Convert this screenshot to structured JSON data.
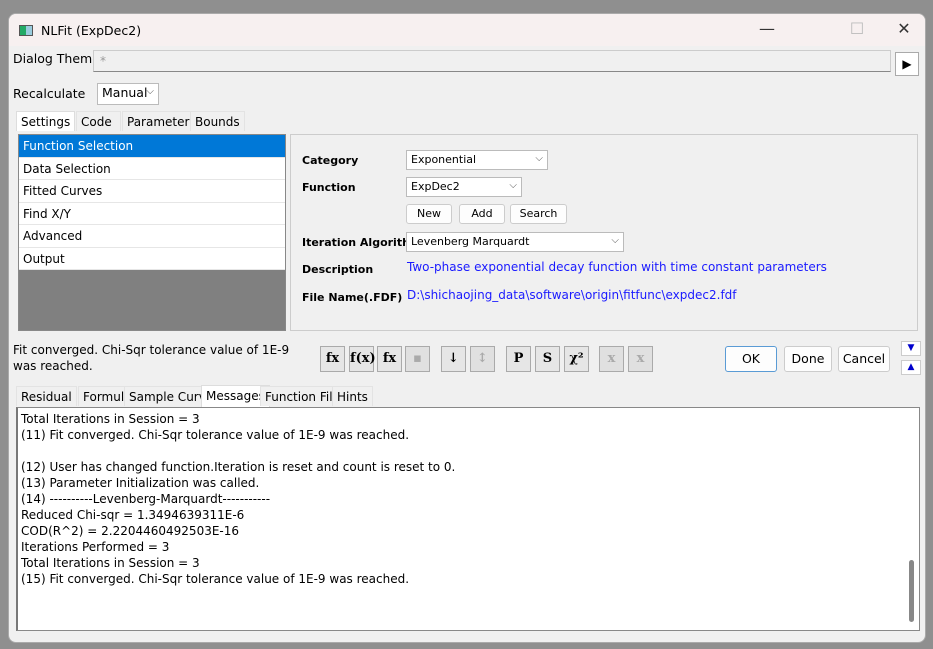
{
  "window": {
    "title": "NLFit (ExpDec2)",
    "minimize": "—",
    "maximize": "☐",
    "close": "✕"
  },
  "theme": {
    "label": "Dialog Theme",
    "value": "*",
    "arrow": "▶"
  },
  "recalc": {
    "label": "Recalculate",
    "value": "Manual"
  },
  "tabs": [
    "Settings",
    "Code",
    "Parameters",
    "Bounds"
  ],
  "nav": [
    "Function Selection",
    "Data Selection",
    "Fitted Curves",
    "Find X/Y",
    "Advanced",
    "Output"
  ],
  "form": {
    "category_label": "Category",
    "category": "Exponential",
    "function_label": "Function",
    "function": "ExpDec2",
    "new": "New",
    "add": "Add",
    "search": "Search",
    "algo_label": "Iteration Algorithm",
    "algo": "Levenberg Marquardt",
    "desc_label": "Description",
    "desc": "Two-phase exponential decay function with time constant parameters",
    "file_label": "File Name(.FDF)",
    "file": "D:\\shichaojing_data\\software\\origin\\fitfunc\\expdec2.fdf"
  },
  "status": "Fit converged. Chi-Sqr tolerance value of 1E-9 was reached.",
  "toolbar": [
    {
      "name": "simplex-icon",
      "glyph": "fx",
      "dis": false
    },
    {
      "name": "edit-function-icon",
      "glyph": "f(x)",
      "dis": false
    },
    {
      "name": "function-file-icon",
      "glyph": "fx",
      "dis": false
    },
    {
      "name": "save-icon",
      "glyph": "▪",
      "dis": true
    },
    {
      "name": "sort-down-icon",
      "glyph": "↓",
      "dis": false
    },
    {
      "name": "sort-updown-icon",
      "glyph": "↕",
      "dis": true
    },
    {
      "name": "param-init-icon",
      "glyph": "P",
      "dis": false
    },
    {
      "name": "iterate-icon",
      "glyph": "S",
      "dis": false
    },
    {
      "name": "chi-square-icon",
      "glyph": "χ²",
      "dis": false
    },
    {
      "name": "one-iteration-icon",
      "glyph": "x",
      "dis": true
    },
    {
      "name": "fit-until-converged-icon",
      "glyph": "x",
      "dis": true
    }
  ],
  "buttons": {
    "ok": "OK",
    "done": "Done",
    "cancel": "Cancel",
    "collapse": "▼",
    "expand": "▲"
  },
  "bottom_tabs": [
    "Residual",
    "Formula",
    "Sample Curve",
    "Messages",
    "Function File",
    "Hints"
  ],
  "messages": [
    "Total Iterations in Session = 3",
    "(11) Fit converged. Chi-Sqr tolerance value of 1E-9 was reached.",
    "",
    "(12) User has changed function.Iteration is reset and count is reset to 0.",
    "(13) Parameter Initialization was called.",
    "(14) ----------Levenberg-Marquardt-----------",
    "Reduced Chi-sqr = 1.3494639311E-6",
    "COD(R^2) = 2.2204460492503E-16",
    "Iterations Performed = 3",
    "Total Iterations in Session = 3",
    "(15) Fit converged. Chi-Sqr tolerance value of 1E-9 was reached."
  ]
}
